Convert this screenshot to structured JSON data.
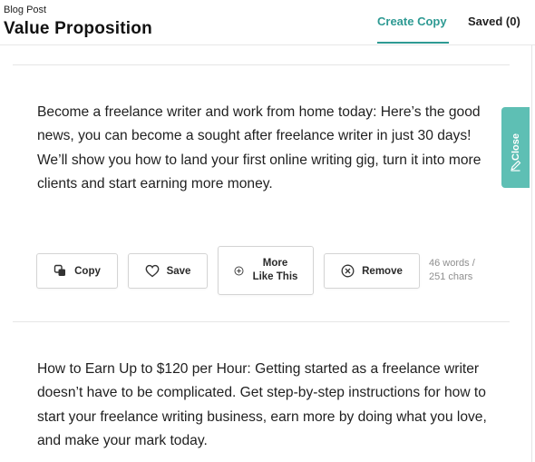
{
  "header": {
    "breadcrumb": "Blog Post",
    "title": "Value Proposition",
    "tabs": {
      "create": "Create Copy",
      "saved": "Saved (0)"
    }
  },
  "results": [
    {
      "text": "Become a freelance writer and work from home today: Here’s the good news, you can become a sought after freelance writer in just 30 days! We’ll show you how to land your first online writing gig, turn it into more clients and start earning more money."
    },
    {
      "text": " How to Earn Up to $120 per Hour: Getting started as a freelance writer doesn’t have to be complicated. Get step-by-step instructions for how to start your freelance writing business, earn more by doing what you love, and make your mark today."
    }
  ],
  "actions": {
    "copy": "Copy",
    "save": "Save",
    "more_line1": "More",
    "more_line2": "Like This",
    "remove": "Remove"
  },
  "stats": {
    "words": "46 words /",
    "chars": "251 chars"
  },
  "close_tab": {
    "label": "Close"
  },
  "colors": {
    "accent": "#2e9a93",
    "close_tab": "#5ebfb4"
  }
}
